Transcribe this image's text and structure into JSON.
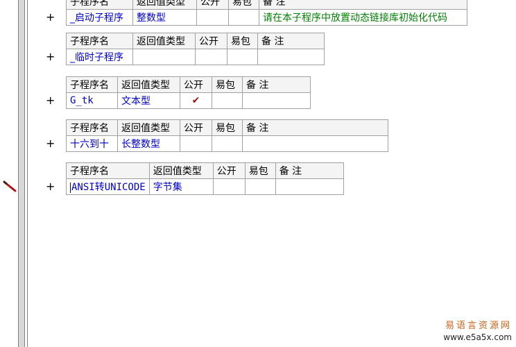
{
  "header_labels": {
    "name": "子程序名",
    "return_type": "返回值类型",
    "public": "公开",
    "easy_pack": "易包",
    "remark": "备 注"
  },
  "expand_symbol": "+",
  "public_check": "✔",
  "procedures": [
    {
      "name": "_启动子程序",
      "return_type": "整数型",
      "public": false,
      "remark": "请在本子程序中放置动态链接库初始化代码"
    },
    {
      "name": "_临时子程序",
      "return_type": "",
      "public": false,
      "remark": ""
    },
    {
      "name": "G_tk",
      "return_type": "文本型",
      "public": true,
      "remark": ""
    },
    {
      "name": "十六到十",
      "return_type": "长整数型",
      "public": false,
      "remark": ""
    },
    {
      "name": "ANSI转UNICODE",
      "return_type": "字节集",
      "public": false,
      "remark": "",
      "editing": true
    }
  ],
  "watermark": {
    "line1": "易语言资源网",
    "line2": "www.e5a5x.com"
  },
  "colors": {
    "name_text": "#0000c8",
    "type_text": "#0000c8",
    "remark_text": "#008000",
    "check": "#a01010",
    "grid": "#a0a0a0",
    "header_bg": "#f4f4f4"
  }
}
